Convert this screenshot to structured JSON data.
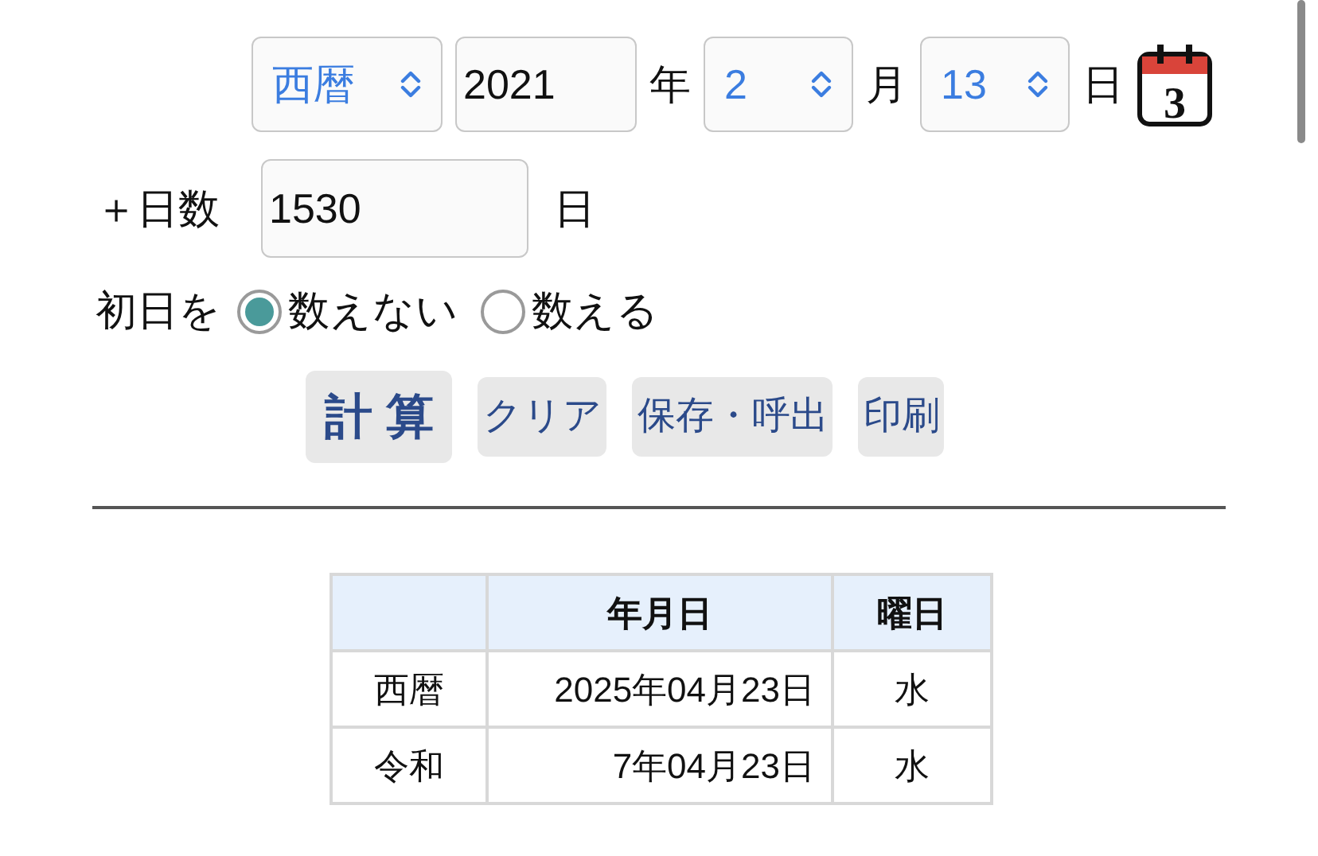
{
  "date_input": {
    "era": "西暦",
    "year": "2021",
    "year_unit": "年",
    "month": "2",
    "month_unit": "月",
    "day": "13",
    "day_unit": "日",
    "calendar_day": "3"
  },
  "days_input": {
    "label": "＋日数",
    "value": "1530",
    "unit": "日"
  },
  "first_day": {
    "label": "初日を",
    "options": [
      {
        "label": "数えない",
        "selected": true
      },
      {
        "label": "数える",
        "selected": false
      }
    ]
  },
  "buttons": [
    {
      "label": "計 算",
      "kind": "primary"
    },
    {
      "label": "クリア",
      "kind": "secondary"
    },
    {
      "label": "保存・呼出",
      "kind": "secondary"
    },
    {
      "label": "印刷",
      "kind": "secondary"
    }
  ],
  "result_table": {
    "columns": [
      "年月日",
      "曜日"
    ],
    "rows": [
      {
        "era": "西暦",
        "date": "2025年04月23日",
        "weekday": "水"
      },
      {
        "era": "令和",
        "date": "7年04月23日",
        "weekday": "水"
      }
    ]
  }
}
